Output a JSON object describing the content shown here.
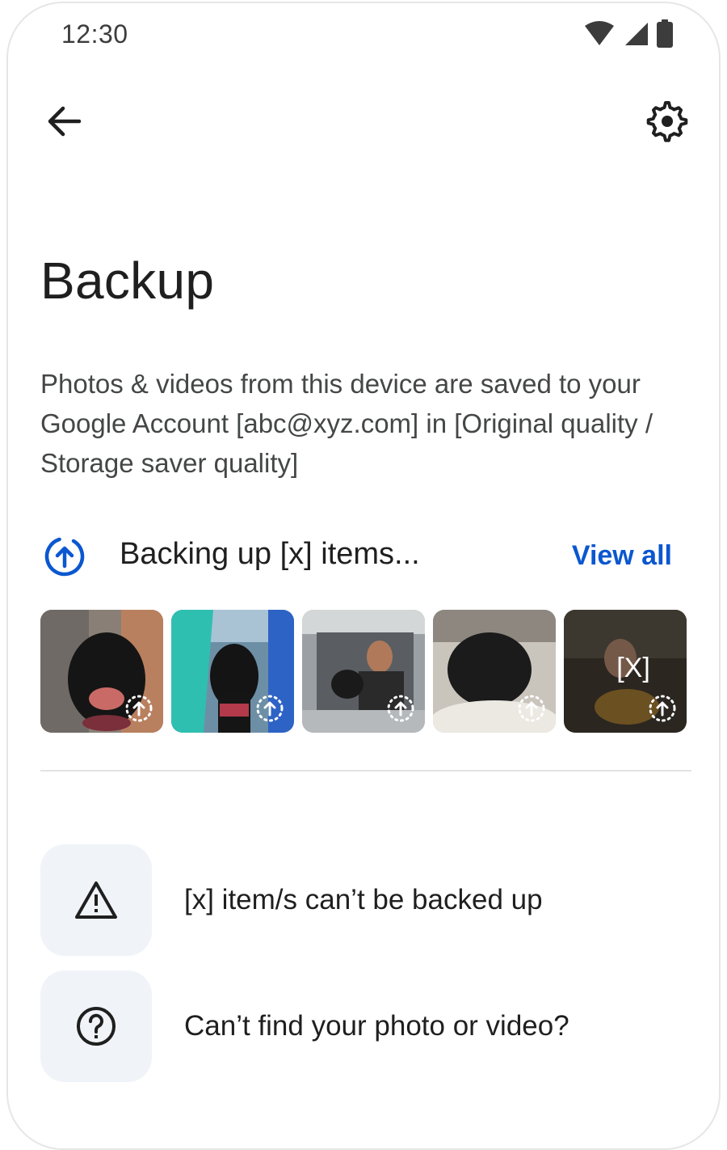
{
  "status_bar": {
    "time": "12:30",
    "icons": [
      "wifi-icon",
      "signal-icon",
      "battery-icon"
    ]
  },
  "top_bar": {
    "back_icon": "arrow-back-icon",
    "settings_icon": "gear-icon"
  },
  "page": {
    "title": "Backup",
    "description": "Photos & videos from this device are saved to your Google Account [abc@xyz.com] in [Original quality / Storage saver quality]"
  },
  "backup_progress": {
    "icon": "upload-progress-icon",
    "status_text": "Backing up [x] items...",
    "view_all_label": "View all",
    "thumbnails": [
      {
        "name": "black-dog-portrait"
      },
      {
        "name": "dog-with-surfboard"
      },
      {
        "name": "man-with-dog-in-car"
      },
      {
        "name": "black-puppy-on-blanket"
      },
      {
        "name": "baby-with-pancakes",
        "overlay_text": "[X]"
      }
    ]
  },
  "list_items": [
    {
      "icon": "warning-icon",
      "label": "[x] item/s can’t be backed up"
    },
    {
      "icon": "help-icon",
      "label": "Can’t find your photo or video?"
    }
  ],
  "colors": {
    "accent": "#0b57d0",
    "text_primary": "#1f1f1f",
    "text_secondary": "#444746",
    "icon_box_bg": "#f0f4f9",
    "divider": "#e3e3e3"
  }
}
